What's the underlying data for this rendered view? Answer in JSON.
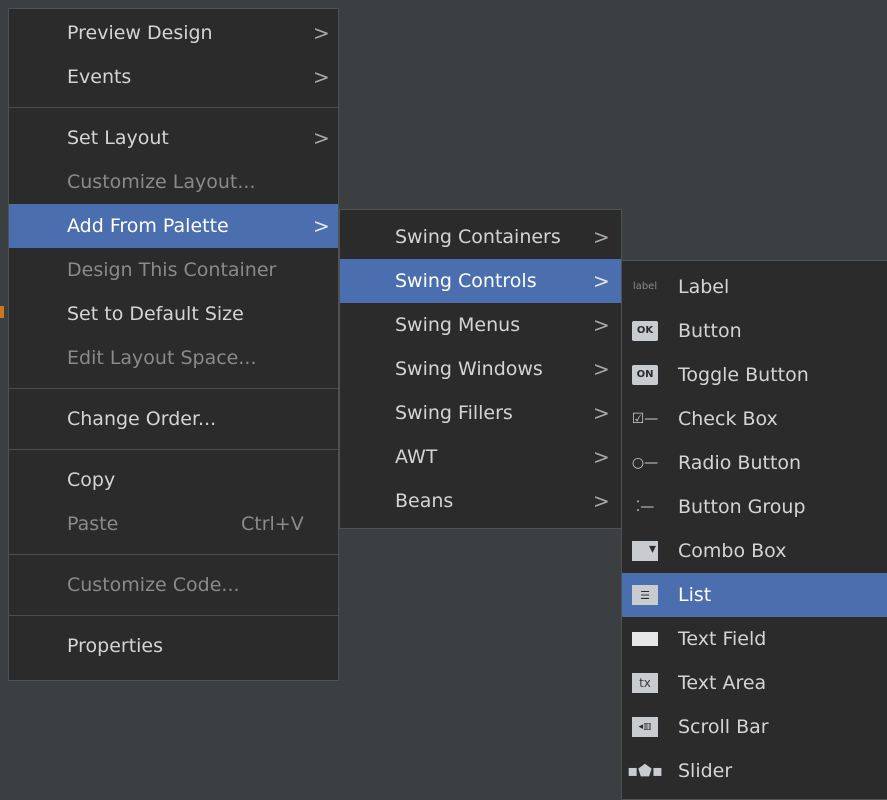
{
  "menu1": {
    "items": [
      {
        "label": "Preview Design",
        "has_submenu": true
      },
      {
        "label": "Events",
        "has_submenu": true
      },
      {
        "label": "Set Layout",
        "has_submenu": true
      },
      {
        "label": "Customize Layout...",
        "disabled": true
      },
      {
        "label": "Add From Palette",
        "has_submenu": true,
        "active": true
      },
      {
        "label": "Design This Container",
        "disabled": true
      },
      {
        "label": "Set to Default Size"
      },
      {
        "label": "Edit Layout Space...",
        "disabled": true
      },
      {
        "label": "Change Order..."
      },
      {
        "label": "Copy"
      },
      {
        "label": "Paste",
        "shortcut": "Ctrl+V",
        "disabled": true
      },
      {
        "label": "Customize Code...",
        "disabled": true
      },
      {
        "label": "Properties"
      }
    ],
    "chevron": ">"
  },
  "menu2": {
    "items": [
      {
        "label": "Swing Containers",
        "has_submenu": true
      },
      {
        "label": "Swing Controls",
        "has_submenu": true,
        "active": true
      },
      {
        "label": "Swing Menus",
        "has_submenu": true
      },
      {
        "label": "Swing Windows",
        "has_submenu": true
      },
      {
        "label": "Swing Fillers",
        "has_submenu": true
      },
      {
        "label": "AWT",
        "has_submenu": true
      },
      {
        "label": "Beans",
        "has_submenu": true
      }
    ]
  },
  "menu3": {
    "items": [
      {
        "label": "Label",
        "icon": "label-icon",
        "icon_text": "label"
      },
      {
        "label": "Button",
        "icon": "button-icon",
        "icon_text": "OK"
      },
      {
        "label": "Toggle Button",
        "icon": "toggle-button-icon",
        "icon_text": "ON"
      },
      {
        "label": "Check Box",
        "icon": "check-box-icon",
        "icon_text": "☑—"
      },
      {
        "label": "Radio Button",
        "icon": "radio-button-icon",
        "icon_text": "○—"
      },
      {
        "label": "Button Group",
        "icon": "button-group-icon",
        "icon_text": "⁚—"
      },
      {
        "label": "Combo Box",
        "icon": "combo-box-icon",
        "icon_text": ""
      },
      {
        "label": "List",
        "icon": "list-icon",
        "icon_text": "☰",
        "active": true
      },
      {
        "label": "Text Field",
        "icon": "text-field-icon",
        "icon_text": ""
      },
      {
        "label": "Text Area",
        "icon": "text-area-icon",
        "icon_text": "tx"
      },
      {
        "label": "Scroll Bar",
        "icon": "scroll-bar-icon",
        "icon_text": "◂▥"
      },
      {
        "label": "Slider",
        "icon": "slider-icon",
        "icon_text": "▪⬟▪"
      }
    ]
  },
  "colors": {
    "background": "#3c3f41",
    "menu_bg": "#2b2b2b",
    "highlight": "#4b6eaf",
    "text": "#d4d4d4",
    "disabled_text": "#8a8a8a"
  }
}
